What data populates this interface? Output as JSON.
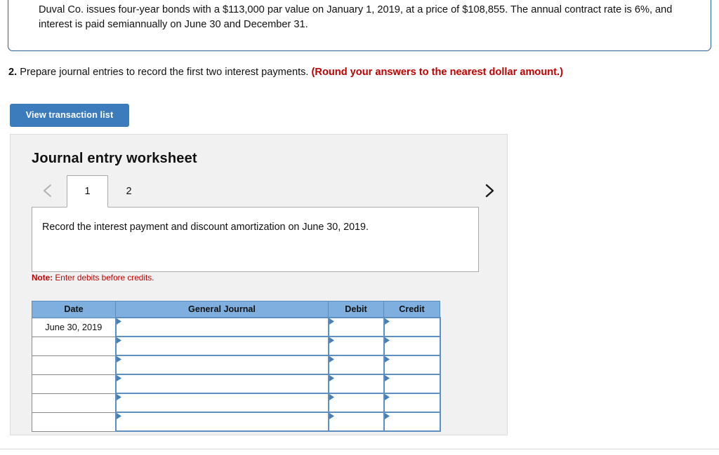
{
  "problem": {
    "text": "Duval Co. issues four-year bonds with a $113,000 par value on January 1, 2019, at a price of $108,855. The annual contract rate is 6%, and interest is paid semiannually on June 30 and December 31."
  },
  "question": {
    "number": "2.",
    "text": "Prepare journal entries to record the first two interest payments.",
    "round_note": "(Round your answers to the nearest dollar amount.)"
  },
  "toolbar": {
    "view_transaction_list_label": "View transaction list"
  },
  "worksheet": {
    "title": "Journal entry worksheet",
    "prev_icon": "chevron-left-icon",
    "next_icon": "chevron-right-icon",
    "tabs": [
      {
        "label": "1",
        "active": true
      },
      {
        "label": "2",
        "active": false
      }
    ],
    "active_tab_instruction": "Record the interest payment and discount amortization on June 30, 2019.",
    "note_prefix": "Note:",
    "note_text": " Enter debits before credits.",
    "table": {
      "columns": [
        "Date",
        "General Journal",
        "Debit",
        "Credit"
      ],
      "rows": [
        {
          "date": "June 30, 2019",
          "general_journal": "",
          "debit": "",
          "credit": ""
        },
        {
          "date": "",
          "general_journal": "",
          "debit": "",
          "credit": ""
        },
        {
          "date": "",
          "general_journal": "",
          "debit": "",
          "credit": ""
        },
        {
          "date": "",
          "general_journal": "",
          "debit": "",
          "credit": ""
        },
        {
          "date": "",
          "general_journal": "",
          "debit": "",
          "credit": ""
        },
        {
          "date": "",
          "general_journal": "",
          "debit": "",
          "credit": ""
        }
      ]
    }
  },
  "colors": {
    "problem_border": "#2c5f8d",
    "button_blue": "#3c7cbd",
    "table_header_blue": "#7eafde",
    "cell_border_blue": "#5d8fc0",
    "note_red": "#c00000",
    "panel_bg": "#f1f1f1"
  }
}
